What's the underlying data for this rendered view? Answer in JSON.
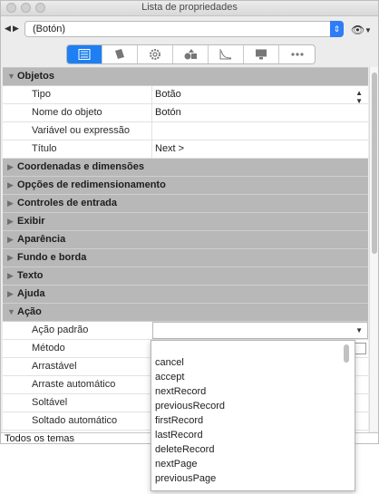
{
  "window": {
    "title": "Lista de propriedades"
  },
  "toolbar": {
    "object_selector_value": "(Botón)"
  },
  "tabs": [
    {
      "name": "tab-properties",
      "icon": "list-icon",
      "active": true
    },
    {
      "name": "tab-book",
      "icon": "book-icon",
      "active": false
    },
    {
      "name": "tab-settings",
      "icon": "gear-icon",
      "active": false
    },
    {
      "name": "tab-shapes",
      "icon": "shapes-icon",
      "active": false
    },
    {
      "name": "tab-chart",
      "icon": "chart-icon",
      "active": false
    },
    {
      "name": "tab-monitor",
      "icon": "monitor-icon",
      "active": false
    },
    {
      "name": "tab-more",
      "icon": "more-icon",
      "active": false
    }
  ],
  "grid": {
    "objetos": {
      "title": "Objetos"
    },
    "props_objetos": [
      {
        "name": "Tipo",
        "value": "Botão"
      },
      {
        "name": "Nome do objeto",
        "value": "Botón"
      },
      {
        "name": "Variável ou expressão",
        "value": ""
      },
      {
        "name": "Título",
        "value": "Next >"
      }
    ],
    "collapsed_categories": [
      "Coordenadas e dimensões",
      "Opções de redimensionamento",
      "Controles de entrada",
      "Exibir",
      "Aparência",
      "Fundo e borda",
      "Texto",
      "Ajuda"
    ],
    "acao": {
      "title": "Ação"
    },
    "props_acao": [
      {
        "name": "Ação padrão",
        "value": ""
      },
      {
        "name": "Método",
        "value": ""
      },
      {
        "name": "Arrastável",
        "value": ""
      },
      {
        "name": "Arraste automático",
        "value": ""
      },
      {
        "name": "Soltável",
        "value": ""
      },
      {
        "name": "Soltado automático",
        "value": ""
      }
    ]
  },
  "footer": {
    "label": "Todos os temas"
  },
  "dropdown": {
    "items": [
      "cancel",
      "accept",
      "nextRecord",
      "previousRecord",
      "firstRecord",
      "lastRecord",
      "deleteRecord",
      "nextPage",
      "previousPage"
    ]
  }
}
